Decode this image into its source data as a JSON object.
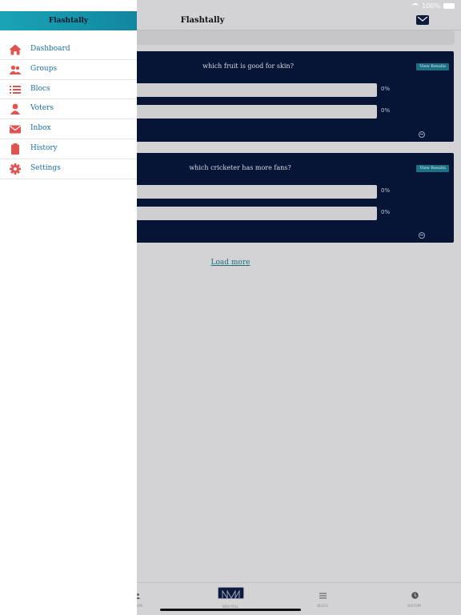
{
  "status_bar": {
    "battery": "100%"
  },
  "app": {
    "title": "Flashtally",
    "load_more": "Load more",
    "polls": [
      {
        "question": "which fruit is good for skin?",
        "view_results": "View Results",
        "options": [
          {
            "percent": "0%"
          },
          {
            "percent": "0%"
          }
        ]
      },
      {
        "question": "which cricketer has more fans?",
        "view_results": "View Results",
        "options": [
          {
            "percent": "0%"
          },
          {
            "percent": "0%"
          }
        ]
      }
    ],
    "tabs": [
      {
        "label": "GROUPS",
        "icon": "groups-icon"
      },
      {
        "label": "NEW POLL",
        "icon": "new-poll-icon"
      },
      {
        "label": "BLOCS",
        "icon": "list-icon"
      },
      {
        "label": "HISTORY",
        "icon": "clock-icon"
      }
    ]
  },
  "drawer": {
    "title": "Flashtally",
    "items": [
      {
        "label": "Dashboard",
        "icon": "home-icon"
      },
      {
        "label": "Groups",
        "icon": "groups-icon"
      },
      {
        "label": "Blocs",
        "icon": "list-icon"
      },
      {
        "label": "Voters",
        "icon": "user-icon"
      },
      {
        "label": "Inbox",
        "icon": "mail-icon"
      },
      {
        "label": "History",
        "icon": "clipboard-icon"
      },
      {
        "label": "Settings",
        "icon": "gear-icon"
      }
    ]
  },
  "colors": {
    "accent": "#1aa3b6",
    "icon": "#e0534f",
    "menu_text": "#1b70a3",
    "card_bg": "#061536",
    "overlay_bg": "#d3d2d4"
  }
}
